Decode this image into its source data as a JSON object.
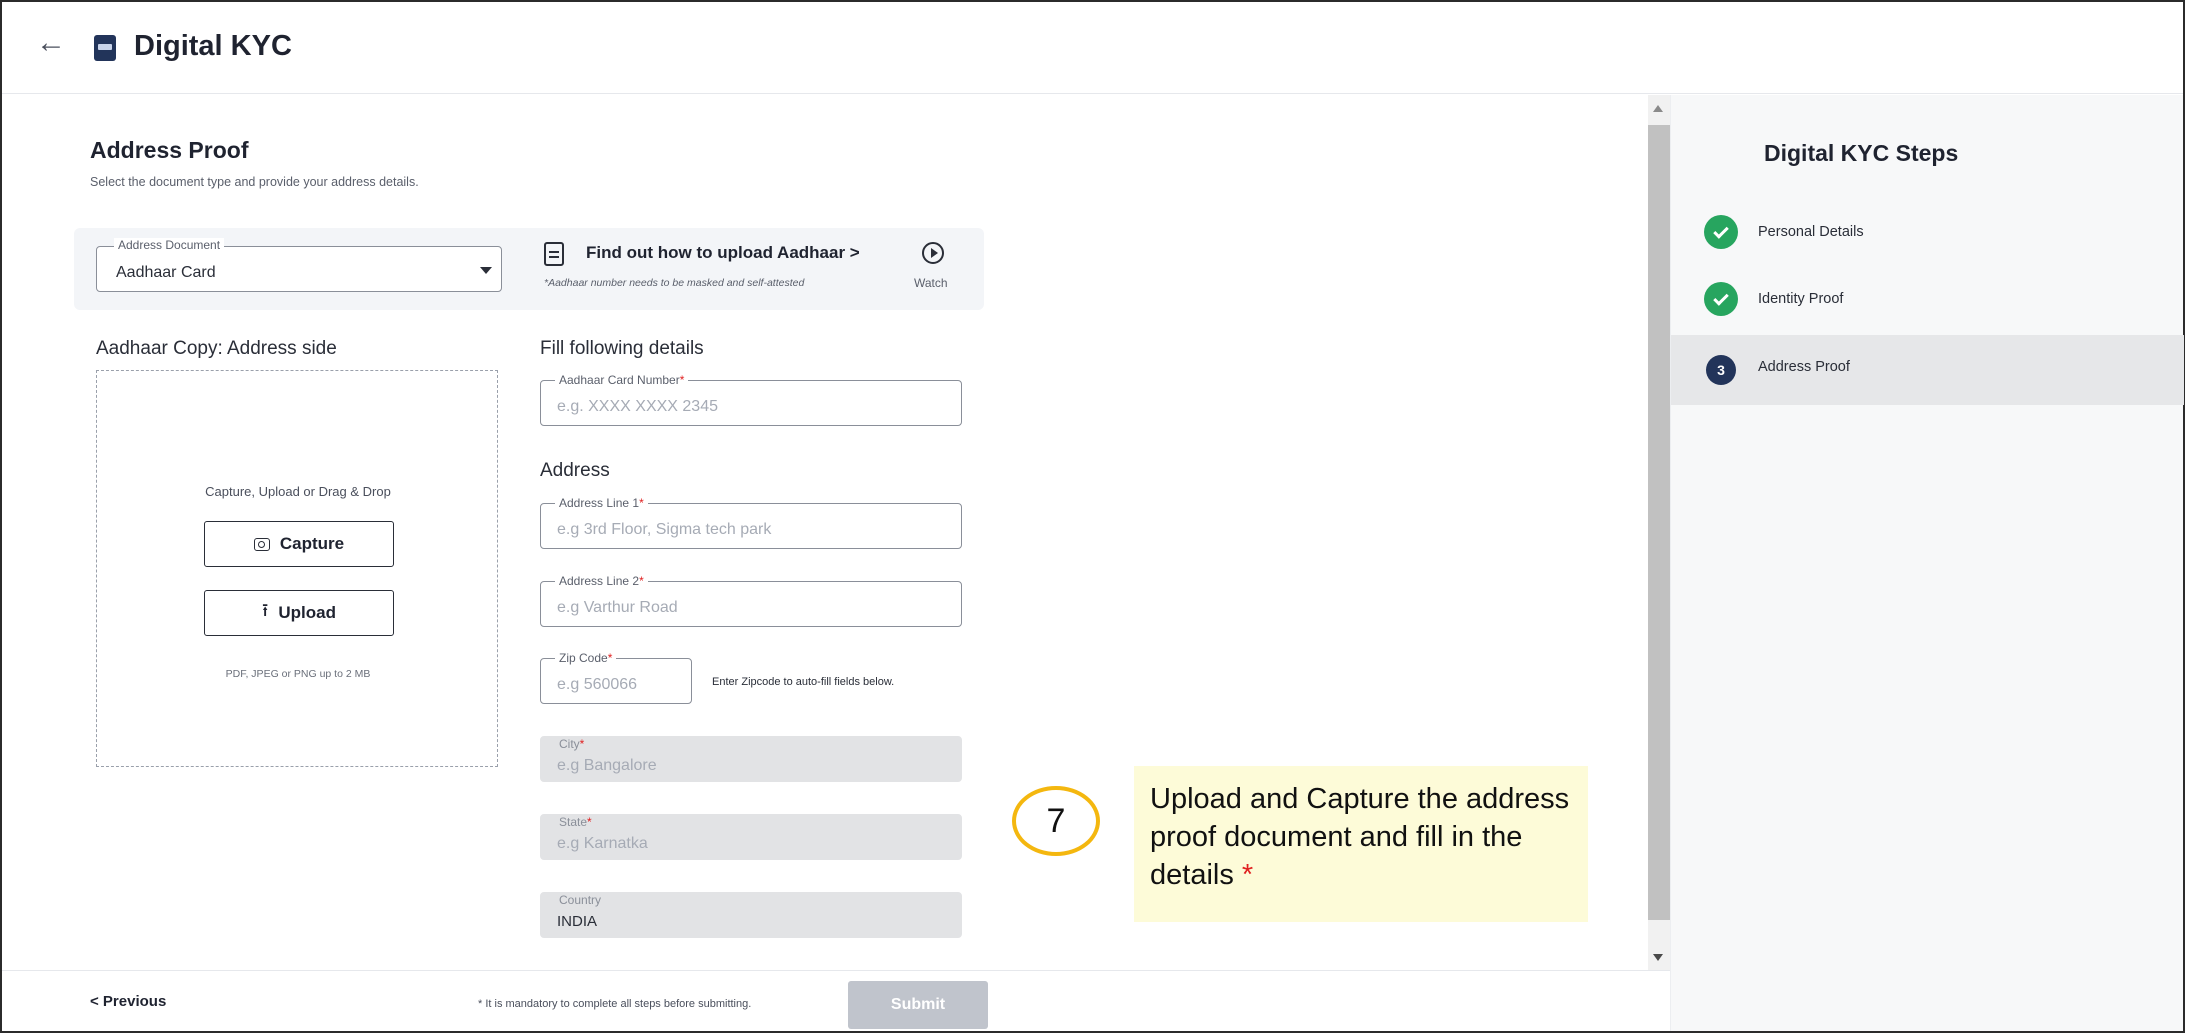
{
  "header": {
    "title": "Digital KYC"
  },
  "section": {
    "title": "Address Proof",
    "subtitle": "Select the document type and provide your address details."
  },
  "address_document": {
    "legend": "Address Document",
    "selected": "Aadhaar Card"
  },
  "help": {
    "link": "Find out how to upload Aadhaar >",
    "note": "*Aadhaar number needs to be masked and self-attested",
    "watch": "Watch"
  },
  "upload": {
    "title": "Aadhaar Copy: Address side",
    "drop_text": "Capture, Upload or Drag & Drop",
    "capture_label": "Capture",
    "upload_label": "Upload",
    "file_hint": "PDF, JPEG or PNG up to 2 MB"
  },
  "form": {
    "title": "Fill following details",
    "address_title": "Address",
    "aadhaar_number": {
      "label": "Aadhaar Card Number",
      "placeholder": "e.g. XXXX XXXX 2345"
    },
    "address_line1": {
      "label": "Address Line 1",
      "placeholder": "e.g 3rd Floor, Sigma tech park"
    },
    "address_line2": {
      "label": "Address Line 2",
      "placeholder": "e.g Varthur Road"
    },
    "zip": {
      "label": "Zip Code",
      "placeholder": "e.g 560066",
      "hint": "Enter Zipcode to auto-fill fields below."
    },
    "city": {
      "label": "City",
      "placeholder": "e.g Bangalore"
    },
    "state": {
      "label": "State",
      "placeholder": "e.g Karnatka"
    },
    "country": {
      "label": "Country",
      "value": "INDIA"
    },
    "required_mark": "*"
  },
  "footer": {
    "previous": "< Previous",
    "note": "* It is mandatory to complete all steps before submitting.",
    "submit": "Submit"
  },
  "annotation": {
    "step_number": "7",
    "text": "Upload and Capture the address proof document and fill in the details",
    "mark": "*"
  },
  "steps": {
    "title": "Digital KYC Steps",
    "items": [
      {
        "label": "Personal Details",
        "status": "done"
      },
      {
        "label": "Identity Proof",
        "status": "done"
      },
      {
        "label": "Address Proof",
        "status": "current",
        "number": "3"
      }
    ]
  },
  "colors": {
    "accent_dark": "#22345a",
    "success": "#27a55f",
    "required": "#e02020",
    "annotation_ring": "#f4b70f",
    "annotation_bg": "#fdfbd8",
    "submit_disabled": "#c0c4cc"
  }
}
